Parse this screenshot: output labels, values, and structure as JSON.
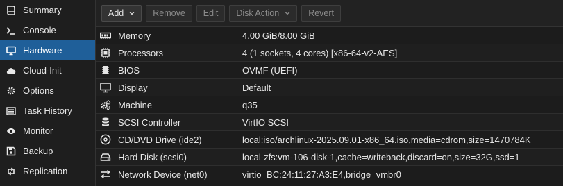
{
  "sidebar": {
    "items": [
      {
        "label": "Summary",
        "icon": "book-icon",
        "active": false
      },
      {
        "label": "Console",
        "icon": "terminal-icon",
        "active": false
      },
      {
        "label": "Hardware",
        "icon": "monitor-icon",
        "active": true
      },
      {
        "label": "Cloud-Init",
        "icon": "cloud-icon",
        "active": false
      },
      {
        "label": "Options",
        "icon": "gear-icon",
        "active": false
      },
      {
        "label": "Task History",
        "icon": "list-icon",
        "active": false
      },
      {
        "label": "Monitor",
        "icon": "eye-icon",
        "active": false
      },
      {
        "label": "Backup",
        "icon": "floppy-icon",
        "active": false
      },
      {
        "label": "Replication",
        "icon": "retweet-icon",
        "active": false
      }
    ]
  },
  "toolbar": {
    "add_label": "Add",
    "remove_label": "Remove",
    "edit_label": "Edit",
    "disk_action_label": "Disk Action",
    "revert_label": "Revert"
  },
  "hardware": {
    "rows": [
      {
        "key": "Memory",
        "value": "4.00 GiB/8.00 GiB",
        "icon": "memory-icon"
      },
      {
        "key": "Processors",
        "value": "4 (1 sockets, 4 cores) [x86-64-v2-AES]",
        "icon": "cpu-icon"
      },
      {
        "key": "BIOS",
        "value": "OVMF (UEFI)",
        "icon": "chip-icon"
      },
      {
        "key": "Display",
        "value": "Default",
        "icon": "desktop-icon"
      },
      {
        "key": "Machine",
        "value": "q35",
        "icon": "cogs-icon"
      },
      {
        "key": "SCSI Controller",
        "value": "VirtIO SCSI",
        "icon": "database-icon"
      },
      {
        "key": "CD/DVD Drive (ide2)",
        "value": "local:iso/archlinux-2025.09.01-x86_64.iso,media=cdrom,size=1470784K",
        "icon": "cdrom-icon"
      },
      {
        "key": "Hard Disk (scsi0)",
        "value": "local-zfs:vm-106-disk-1,cache=writeback,discard=on,size=32G,ssd=1",
        "icon": "harddisk-icon"
      },
      {
        "key": "Network Device (net0)",
        "value": "virtio=BC:24:11:27:A3:E4,bridge=vmbr0",
        "icon": "exchange-icon"
      }
    ]
  },
  "colors": {
    "accent": "#1f5f99",
    "background": "#1c1c1c"
  }
}
